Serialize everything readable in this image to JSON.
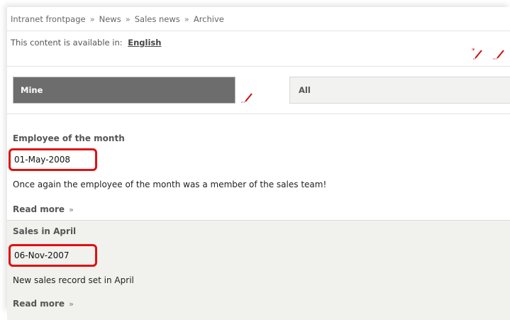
{
  "breadcrumb": [
    "Intranet frontpage",
    "News",
    "Sales news",
    "Archive"
  ],
  "breadcrumb_sep": "»",
  "language": {
    "label": "This content is available in:",
    "value": "English"
  },
  "tabs": [
    {
      "label": "Mine",
      "active": true
    },
    {
      "label": "All",
      "active": false
    }
  ],
  "news": [
    {
      "title": "Employee of the month",
      "date": "01-May-2008",
      "summary": "Once again the employee of the month was a member of the sales team!",
      "read_more": "Read more",
      "read_more_icon": "»"
    },
    {
      "title": "Sales in April",
      "date": "06-Nov-2007",
      "summary": "New sales record set in April",
      "read_more": "Read more",
      "read_more_icon": "»"
    }
  ],
  "colors": {
    "accent_red": "#e01010",
    "tab_active": "#6d6d6d",
    "alt_row": "#f1f1ee"
  }
}
